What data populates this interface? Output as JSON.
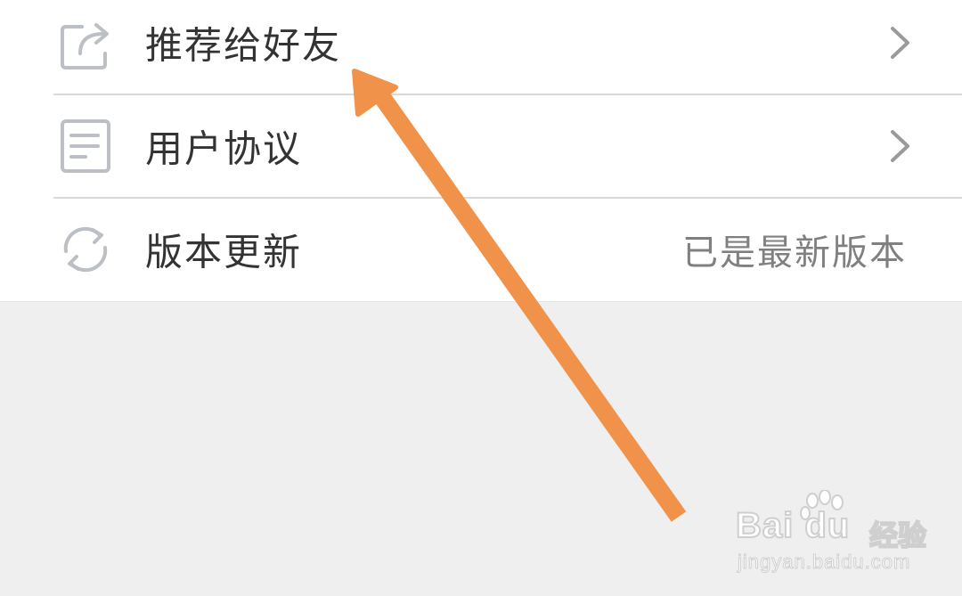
{
  "settings": {
    "items": [
      {
        "label": "推荐给好友",
        "icon": "share-icon",
        "trailing": "chevron-right-icon"
      },
      {
        "label": "用户协议",
        "icon": "document-icon",
        "trailing": "chevron-right-icon"
      },
      {
        "label": "版本更新",
        "icon": "refresh-icon",
        "value": "已是最新版本"
      }
    ]
  },
  "annotation": {
    "arrow_color": "#f0924a",
    "arrow_icon": "arrow-pointer-icon"
  },
  "watermark": {
    "brand": "Bai du",
    "product": "经验",
    "url": "jingyan.baidu.com"
  },
  "colors": {
    "background": "#efefef",
    "card": "#ffffff",
    "divider": "#d9d9d9",
    "icon": "#bcc0c6",
    "label_text": "#333333",
    "value_text": "#808080"
  }
}
